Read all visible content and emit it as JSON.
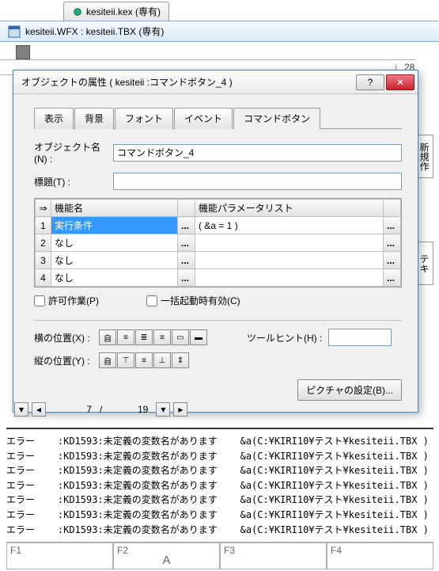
{
  "file_tabs": {
    "tab1": "kesiteii.kex (専有)"
  },
  "child_window": "kesiteii.WFX : kesiteii.TBX (専有)",
  "ruler_value": "28",
  "side": {
    "newrec": "新規作",
    "text": "テキ"
  },
  "dialog": {
    "title": "オブジェクトの属性 ( kesiteii :コマンドボタン_4 )",
    "tabs": {
      "t1": "表示",
      "t2": "背景",
      "t3": "フォント",
      "t4": "イベント",
      "t5": "コマンドボタン"
    },
    "obj_name_label": "オブジェクト名(N) :",
    "obj_name_value": "コマンドボタン_4",
    "caption_label": "標題(T) :",
    "caption_value": "",
    "grid": {
      "hdr_arrow": "⇒",
      "hdr_func": "機能名",
      "hdr_param": "機能パラメータリスト",
      "rows": [
        {
          "n": "1",
          "func": "実行条件",
          "param": "( &a = 1 )"
        },
        {
          "n": "2",
          "func": "なし",
          "param": ""
        },
        {
          "n": "3",
          "func": "なし",
          "param": ""
        },
        {
          "n": "4",
          "func": "なし",
          "param": ""
        }
      ]
    },
    "chk_permit": "許可作業(P)",
    "chk_batch": "一括起動時有効(C)",
    "hpos_label": "横の位置(X) :",
    "vpos_label": "縦の位置(Y) :",
    "toolhint_label": "ツールヒント(H) :",
    "toolhint_value": "",
    "pic_button": "ピクチャの設定(B)..."
  },
  "pager": {
    "cur": "7",
    "sep": "/",
    "total": "19"
  },
  "log_line_prefix": "エラー    :KD1593:未定義の変数名があります",
  "log_line_suffix": "&a(C:¥KIRI10¥テスト¥kesiteii.TBX )",
  "fkeys": {
    "f1": "F1",
    "f2": "F2",
    "f3": "F3",
    "f4": "F4",
    "f2val": "A"
  }
}
